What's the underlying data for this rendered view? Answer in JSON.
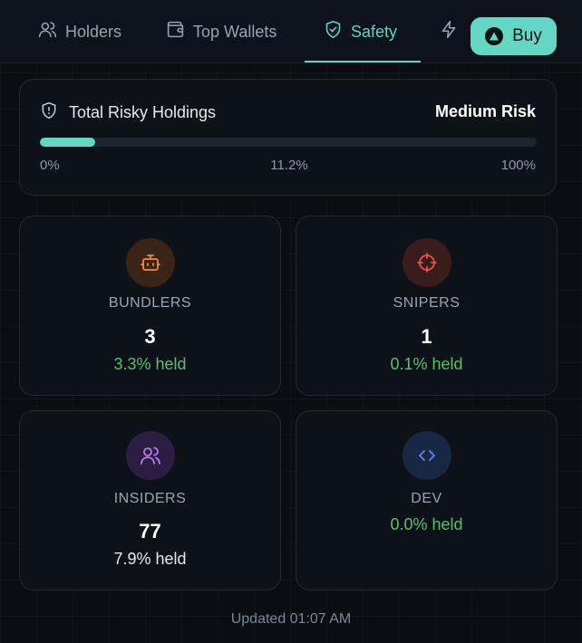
{
  "tabs": [
    {
      "label": "Holders",
      "icon": "users-icon",
      "active": false
    },
    {
      "label": "Top Wallets",
      "icon": "wallet-icon",
      "active": false
    },
    {
      "label": "Safety",
      "icon": "shield-check-icon",
      "active": true
    },
    {
      "label": "",
      "icon": "lightning-icon",
      "active": false
    }
  ],
  "buy_button": {
    "label": "Buy",
    "icon": "triangle-circle-icon"
  },
  "risk": {
    "title": "Total Risky Holdings",
    "level": "Medium Risk",
    "percent": 11.2,
    "percent_label": "11.2%",
    "min_label": "0%",
    "max_label": "100%"
  },
  "stats": {
    "bundlers": {
      "label": "BUNDLERS",
      "count": "3",
      "held": "3.3% held",
      "icon": "bot-icon",
      "color": "#f08a3c"
    },
    "snipers": {
      "label": "SNIPERS",
      "count": "1",
      "held": "0.1% held",
      "icon": "crosshair-icon",
      "color": "#e5534b"
    },
    "insiders": {
      "label": "INSIDERS",
      "count": "77",
      "held": "7.9% held",
      "icon": "users-icon",
      "color": "#b57be8"
    },
    "dev": {
      "label": "DEV",
      "held": "0.0% held",
      "icon": "code-icon",
      "color": "#4f8ef0"
    }
  },
  "colors": {
    "accent": "#63d7c4",
    "held_green": "#5bbf72",
    "held_neutral": "#e6e8ec"
  },
  "updated": "Updated 01:07 AM"
}
